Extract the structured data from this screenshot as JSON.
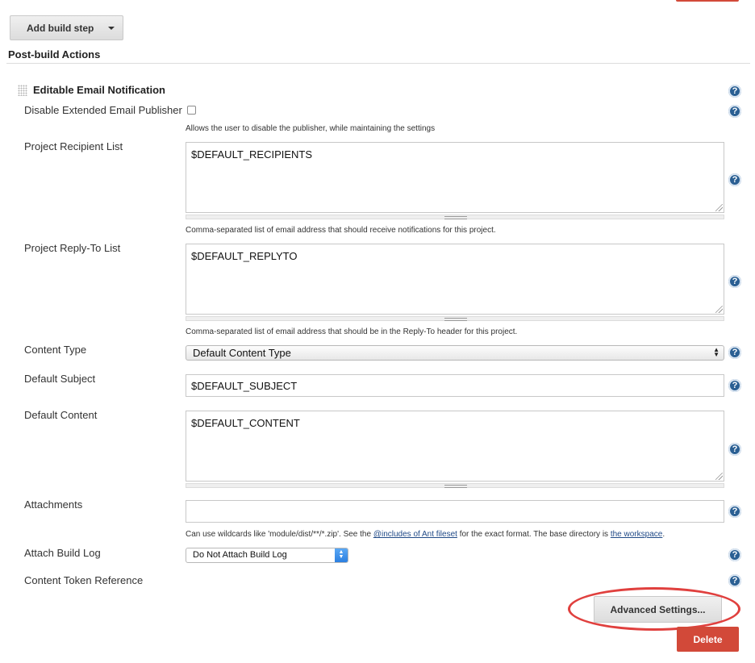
{
  "toolbar": {
    "add_build_step_label": "Add build step"
  },
  "section": {
    "title": "Post-build Actions"
  },
  "plugin": {
    "title": "Editable Email Notification"
  },
  "fields": {
    "disable_publisher": {
      "label": "Disable Extended Email Publisher",
      "checked": false,
      "description": "Allows the user to disable the publisher, while maintaining the settings"
    },
    "recipient_list": {
      "label": "Project Recipient List",
      "value": "$DEFAULT_RECIPIENTS",
      "description": "Comma-separated list of email address that should receive notifications for this project."
    },
    "reply_to_list": {
      "label": "Project Reply-To List",
      "value": "$DEFAULT_REPLYTO",
      "description": "Comma-separated list of email address that should be in the Reply-To header for this project."
    },
    "content_type": {
      "label": "Content Type",
      "selected": "Default Content Type"
    },
    "default_subject": {
      "label": "Default Subject",
      "value": "$DEFAULT_SUBJECT"
    },
    "default_content": {
      "label": "Default Content",
      "value": "$DEFAULT_CONTENT"
    },
    "attachments": {
      "label": "Attachments",
      "value": "",
      "description_prefix": "Can use wildcards like 'module/dist/**/*.zip'. See the ",
      "link_includes": "@includes of Ant fileset",
      "description_middle": " for the exact format. The base directory is ",
      "link_workspace": "the workspace",
      "description_suffix": "."
    },
    "attach_build_log": {
      "label": "Attach Build Log",
      "selected": "Do Not Attach Build Log"
    },
    "content_token_reference": {
      "label": "Content Token Reference"
    }
  },
  "actions": {
    "advanced_label": "Advanced Settings...",
    "delete_label": "Delete"
  },
  "help_glyph": "?",
  "colors": {
    "delete_red": "#d24939",
    "help_blue": "#2a5f93",
    "highlight_red": "#e0403e",
    "link_blue": "#204a87"
  }
}
